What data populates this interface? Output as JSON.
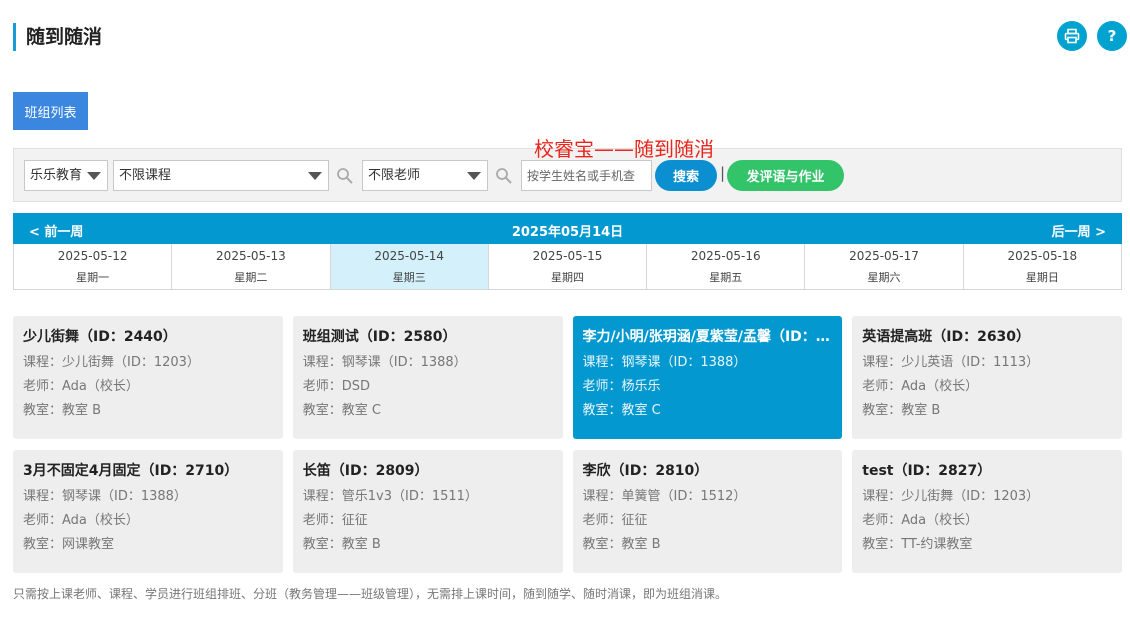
{
  "header": {
    "title": "随到随消",
    "print_icon": "printer-icon",
    "help_label": "?"
  },
  "tabs": {
    "class_list": "班组列表"
  },
  "annotation": "校睿宝——随到随消",
  "filters": {
    "org": "乐乐教育",
    "course": "不限课程",
    "teacher": "不限老师",
    "student_placeholder": "按学生姓名或手机查",
    "search_label": "搜索",
    "separator": "|",
    "comment_label": "发评语与作业"
  },
  "week": {
    "prev_label": "< 前一周",
    "current_date": "2025年05月14日",
    "next_label": "后一周 >",
    "days": [
      {
        "date": "2025-05-12",
        "weekday": "星期一"
      },
      {
        "date": "2025-05-13",
        "weekday": "星期二"
      },
      {
        "date": "2025-05-14",
        "weekday": "星期三"
      },
      {
        "date": "2025-05-15",
        "weekday": "星期四"
      },
      {
        "date": "2025-05-16",
        "weekday": "星期五"
      },
      {
        "date": "2025-05-17",
        "weekday": "星期六"
      },
      {
        "date": "2025-05-18",
        "weekday": "星期日"
      }
    ]
  },
  "cards": [
    {
      "title": "少儿街舞（ID：2440）",
      "course": "课程：少儿街舞（ID：1203）",
      "teacher": "老师：Ada（校长）",
      "room": "教室：教室 B"
    },
    {
      "title": "班组测试（ID：2580）",
      "course": "课程：钢琴课（ID：1388）",
      "teacher": "老师：DSD",
      "room": "教室：教室 C"
    },
    {
      "title": "李力/小明/张玥涵/夏紫莹/孟馨（ID：…",
      "course": "课程：钢琴课（ID：1388）",
      "teacher": "老师：杨乐乐",
      "room": "教室：教室 C"
    },
    {
      "title": "英语提高班（ID：2630）",
      "course": "课程：少儿英语（ID：1113）",
      "teacher": "老师：Ada（校长）",
      "room": "教室：教室 B"
    },
    {
      "title": "3月不固定4月固定（ID：2710）",
      "course": "课程：钢琴课（ID：1388）",
      "teacher": "老师：Ada（校长）",
      "room": "教室：网课教室"
    },
    {
      "title": "长笛（ID：2809）",
      "course": "课程：管乐1v3（ID：1511）",
      "teacher": "老师：征征",
      "room": "教室：教室 B"
    },
    {
      "title": "李欣（ID：2810）",
      "course": "课程：单簧管（ID：1512）",
      "teacher": "老师：征征",
      "room": "教室：教室 B"
    },
    {
      "title": "test（ID：2827）",
      "course": "课程：少儿街舞（ID：1203）",
      "teacher": "老师：Ada（校长）",
      "room": "教室：TT-约课教室"
    }
  ],
  "footnote": "只需按上课老师、课程、学员进行班组排班、分班（教务管理——班级管理），无需排上课时间，随到随学、随时消课，即为班组消课。"
}
